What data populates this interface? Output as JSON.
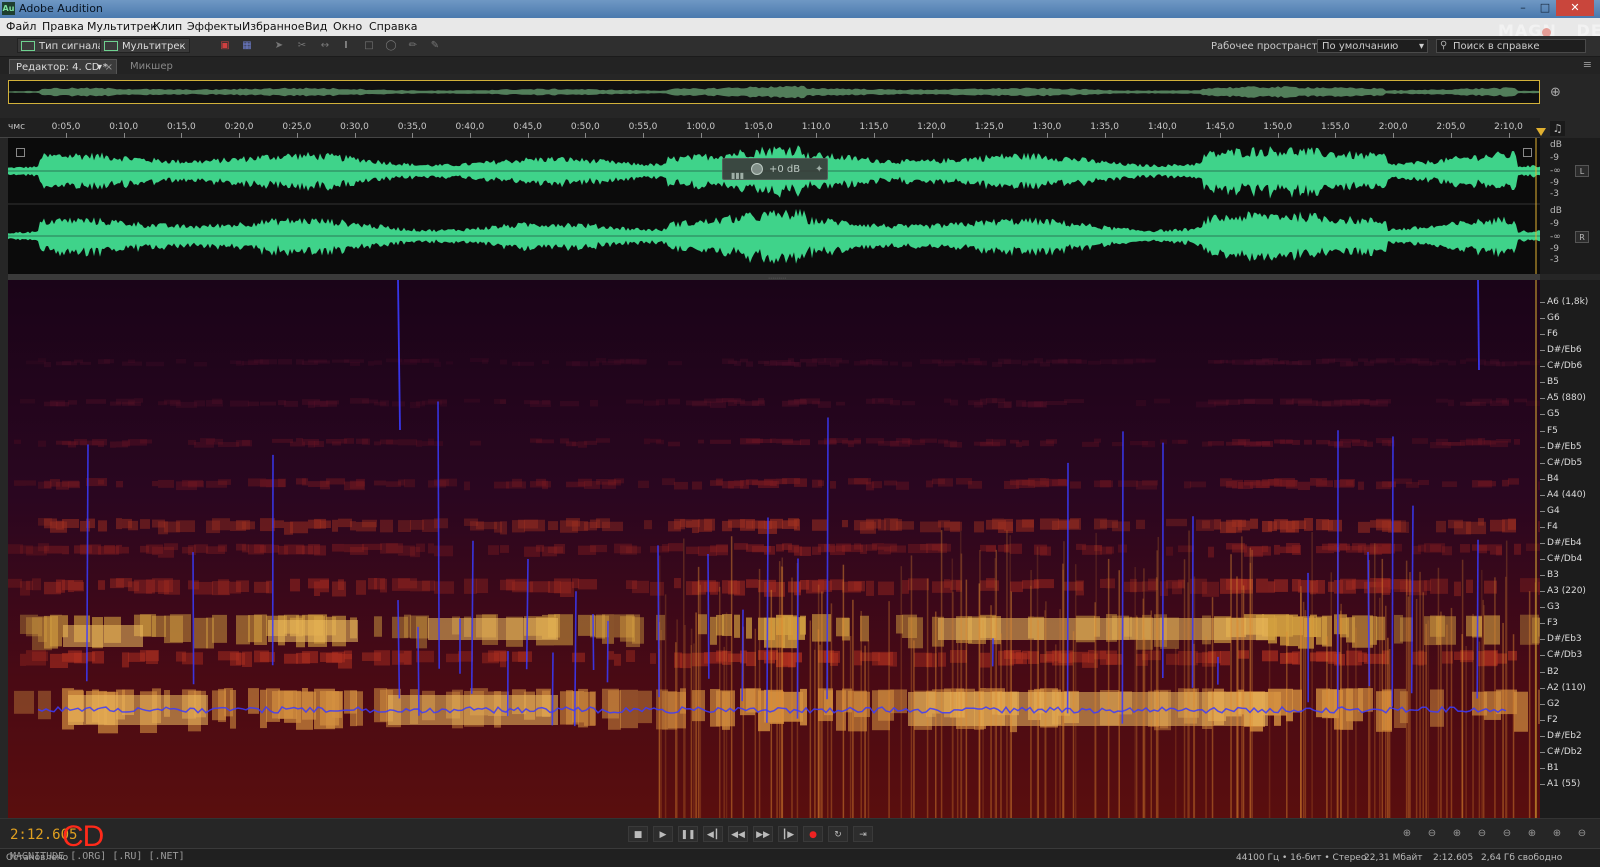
{
  "window": {
    "title": "Adobe Audition",
    "icon_label": "Au"
  },
  "menu": [
    "Файл",
    "Правка",
    "Мультитрек",
    "Клип",
    "Эффекты",
    "Избранное",
    "Вид",
    "Окно",
    "Справка"
  ],
  "toolbar": {
    "waveform_label": "Тип сигнала",
    "multitrack_label": "Мультитрек",
    "workspace_label": "Рабочее пространство:",
    "workspace_value": "По умолчанию",
    "search_placeholder": "Поиск в справке"
  },
  "tabs": {
    "editor": "Редактор: 4. CD *",
    "mixer": "Микшер"
  },
  "ruler": {
    "unit": "чмс",
    "labels": [
      "0:05,0",
      "0:10,0",
      "0:15,0",
      "0:20,0",
      "0:25,0",
      "0:30,0",
      "0:35,0",
      "0:40,0",
      "0:45,0",
      "0:50,0",
      "0:55,0",
      "1:00,0",
      "1:05,0",
      "1:10,0",
      "1:15,0",
      "1:20,0",
      "1:25,0",
      "1:30,0",
      "1:35,0",
      "1:40,0",
      "1:45,0",
      "1:50,0",
      "1:55,0",
      "2:00,0",
      "2:05,0",
      "2:10,0"
    ]
  },
  "hud": {
    "gain": "+0 dB"
  },
  "db_scale": {
    "left_channel": [
      "dB",
      "-9",
      "-∞",
      "-9",
      "-3"
    ],
    "right_channel": [
      "dB",
      "-9",
      "-∞",
      "-9",
      "-3"
    ],
    "left_badge": "L",
    "right_badge": "R"
  },
  "pitch_scale": [
    "A6 (1,8k)",
    "G6",
    "F6",
    "D#/Eb6",
    "C#/Db6",
    "B5",
    "A5 (880)",
    "G5",
    "F5",
    "D#/Eb5",
    "C#/Db5",
    "B4",
    "A4 (440)",
    "G4",
    "F4",
    "D#/Eb4",
    "C#/Db4",
    "B3",
    "A3 (220)",
    "G3",
    "F3",
    "D#/Eb3",
    "C#/Db3",
    "B2",
    "A2 (110)",
    "G2",
    "F2",
    "D#/Eb2",
    "C#/Db2",
    "B1",
    "A1 (55)"
  ],
  "transport": {
    "time": "2:12.605",
    "cd_logo": "CD",
    "buttons": [
      "stop",
      "play",
      "pause",
      "go-to-start",
      "rewind",
      "fast-forward",
      "go-to-end",
      "record",
      "loop",
      "skip"
    ]
  },
  "status": {
    "left": "Остановлено",
    "watermark": "MAGNITUDE [.ORG] [.RU] [.NET]",
    "sample_info": "44100 Гц • 16-бит • Стерео",
    "file_size": "22,31 Мбайт",
    "duration": "2:12.605",
    "free_space": "2,64 Гб свободно"
  },
  "corner_logo": "MAGNITUDE",
  "colors": {
    "waveform": "#3fd38a",
    "playhead": "#e0b030",
    "pitch_line": "#3b3bff",
    "time_display": "#e0a020",
    "cd_logo": "#ff2a1a"
  }
}
